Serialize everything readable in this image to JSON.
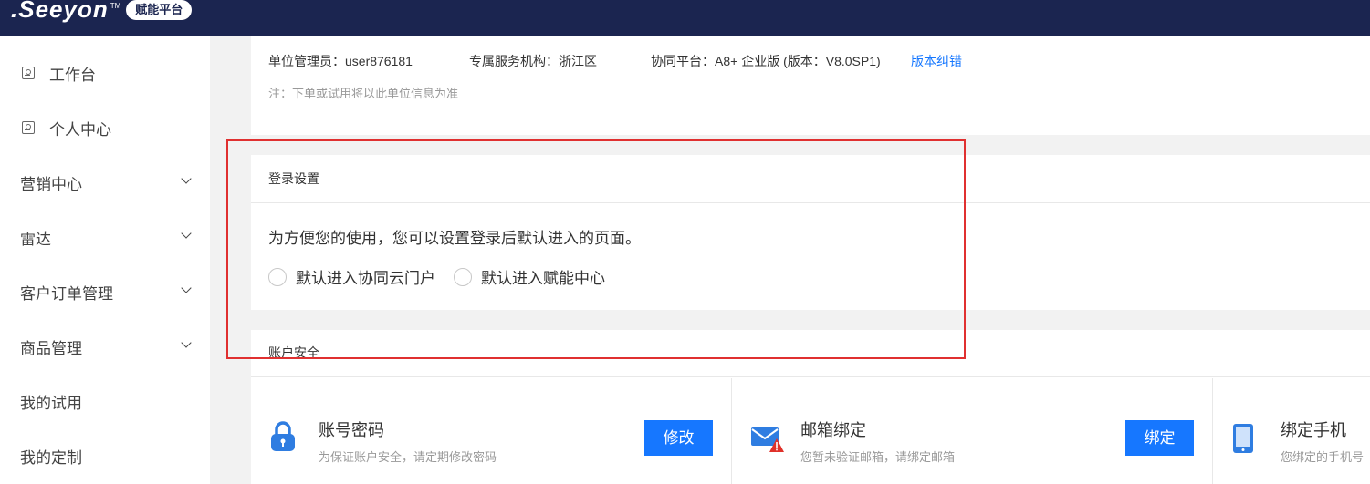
{
  "header": {
    "logo": ".Seeyon",
    "logo_tm": "TM",
    "badge": "赋能平台"
  },
  "sidebar": {
    "items": [
      {
        "label": "工作台",
        "icon": "user-card-icon"
      },
      {
        "label": "个人中心",
        "icon": "user-card-icon"
      },
      {
        "label": "营销中心",
        "expandable": true
      },
      {
        "label": "雷达",
        "expandable": true
      },
      {
        "label": "客户订单管理",
        "expandable": true
      },
      {
        "label": "商品管理",
        "expandable": true
      },
      {
        "label": "我的试用"
      },
      {
        "label": "我的定制"
      }
    ]
  },
  "unit_info": {
    "admin": "单位管理员：user876181",
    "service_org": "专属服务机构：浙江区",
    "platform": "协同平台：A8+ 企业版 (版本：V8.0SP1)",
    "correct_link": "版本纠错",
    "note": "注：下单或试用将以此单位信息为准"
  },
  "login_settings": {
    "title": "登录设置",
    "description": "为方便您的使用，您可以设置登录后默认进入的页面。",
    "options": [
      "默认进入协同云门户",
      "默认进入赋能中心"
    ]
  },
  "account_security": {
    "title": "账户安全",
    "password": {
      "title": "账号密码",
      "subtitle": "为保证账户安全，请定期修改密码",
      "button": "修改"
    },
    "email": {
      "title": "邮箱绑定",
      "subtitle": "您暂未验证邮箱，请绑定邮箱",
      "button": "绑定"
    },
    "phone": {
      "title": "绑定手机",
      "subtitle": "您绑定的手机号"
    }
  },
  "colors": {
    "topbar": "#1b2550",
    "primary": "#1677ff",
    "highlight": "#e03030"
  }
}
